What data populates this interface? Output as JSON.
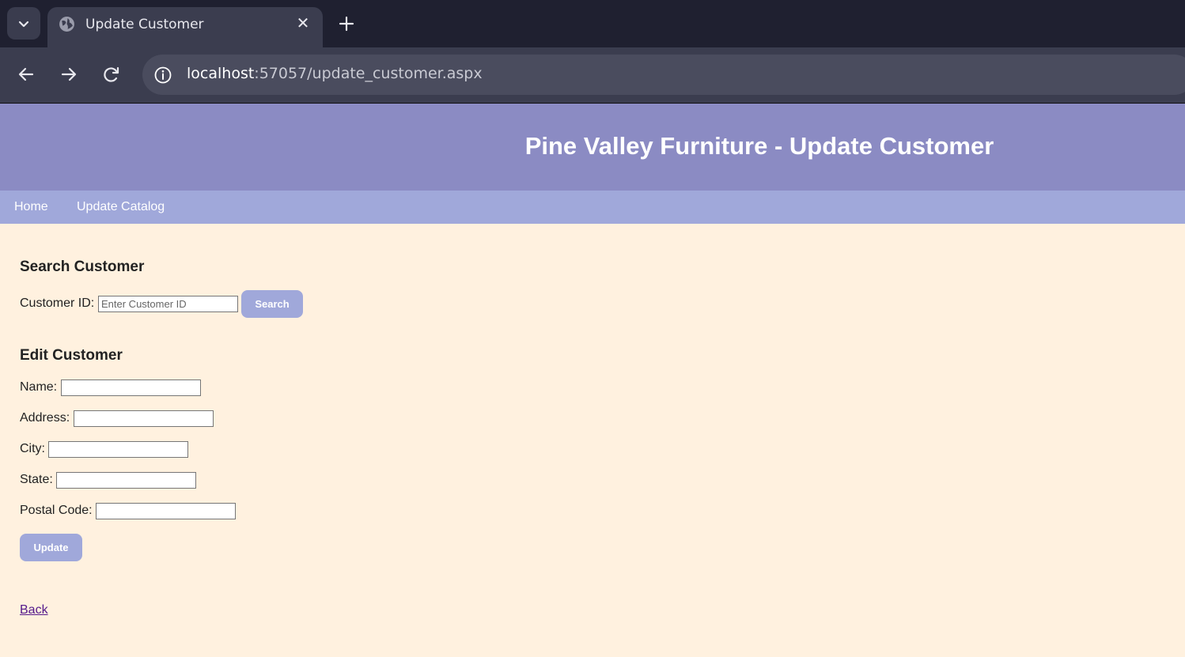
{
  "browser": {
    "tab_title": "Update Customer",
    "url_host": "localhost",
    "url_rest": ":57057/update_customer.aspx"
  },
  "header": {
    "title": "Pine Valley Furniture - Update Customer"
  },
  "nav": {
    "items": [
      {
        "label": "Home"
      },
      {
        "label": "Update Catalog"
      }
    ]
  },
  "search": {
    "section_title": "Search Customer",
    "customer_id_label": "Customer ID:",
    "customer_id_placeholder": "Enter Customer ID",
    "customer_id_value": "",
    "button_label": "Search"
  },
  "edit": {
    "section_title": "Edit Customer",
    "fields": [
      {
        "label": "Name:",
        "value": ""
      },
      {
        "label": "Address:",
        "value": ""
      },
      {
        "label": "City:",
        "value": ""
      },
      {
        "label": "State:",
        "value": ""
      },
      {
        "label": "Postal Code:",
        "value": ""
      }
    ],
    "button_label": "Update"
  },
  "back_link": "Back",
  "colors": {
    "header_bg": "#8b8bc3",
    "nav_bg": "#a0a8da",
    "page_bg": "#fff1df",
    "button_bg": "#a0a8da"
  }
}
